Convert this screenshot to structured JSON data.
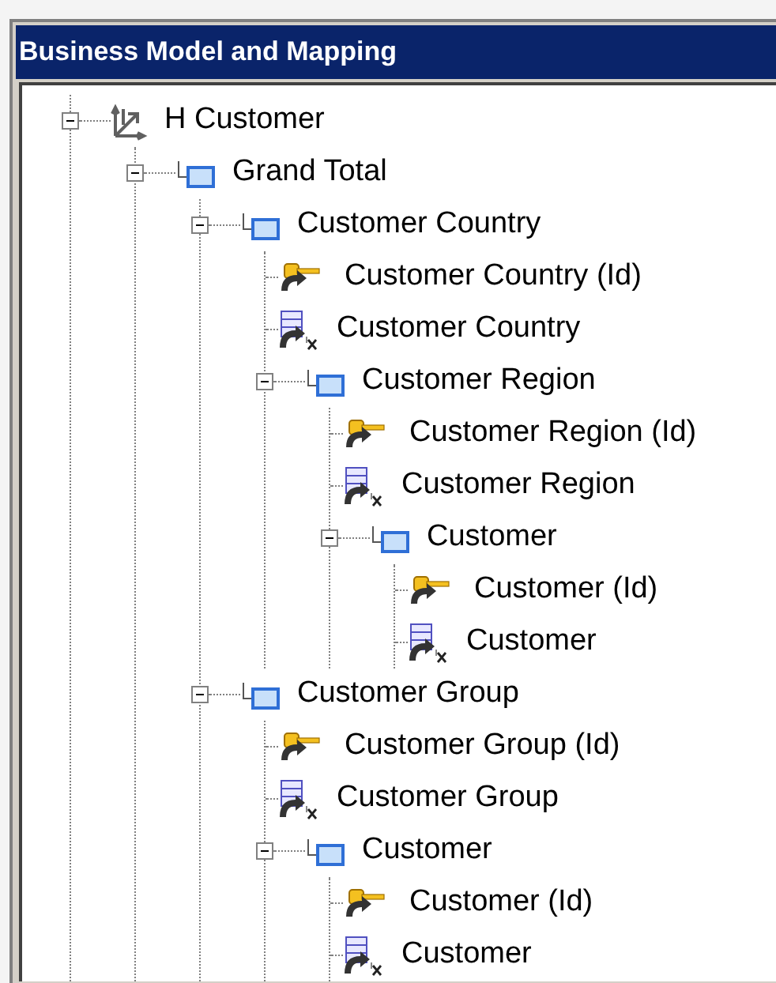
{
  "window": {
    "title": "Business Model and Mapping"
  },
  "tree": [
    {
      "label": "H Customer",
      "kind": "hierarchy",
      "expanded": true,
      "children": [
        {
          "label": "Grand Total",
          "kind": "level",
          "expanded": true,
          "children": [
            {
              "label": "Customer Country",
              "kind": "level",
              "expanded": true,
              "children": [
                {
                  "label": "Customer Country (Id)",
                  "kind": "key"
                },
                {
                  "label": "Customer Country",
                  "kind": "column"
                },
                {
                  "label": "Customer Region",
                  "kind": "level",
                  "expanded": true,
                  "children": [
                    {
                      "label": "Customer Region (Id)",
                      "kind": "key"
                    },
                    {
                      "label": "Customer Region",
                      "kind": "column"
                    },
                    {
                      "label": "Customer",
                      "kind": "level",
                      "expanded": true,
                      "children": [
                        {
                          "label": "Customer (Id)",
                          "kind": "key"
                        },
                        {
                          "label": "Customer",
                          "kind": "column"
                        }
                      ]
                    }
                  ]
                }
              ]
            },
            {
              "label": "Customer Group",
              "kind": "level",
              "expanded": true,
              "children": [
                {
                  "label": "Customer Group (Id)",
                  "kind": "key"
                },
                {
                  "label": "Customer Group",
                  "kind": "column"
                },
                {
                  "label": "Customer",
                  "kind": "level",
                  "expanded": true,
                  "children": [
                    {
                      "label": "Customer (Id)",
                      "kind": "key"
                    },
                    {
                      "label": "Customer",
                      "kind": "column"
                    }
                  ]
                }
              ]
            }
          ]
        }
      ]
    }
  ]
}
